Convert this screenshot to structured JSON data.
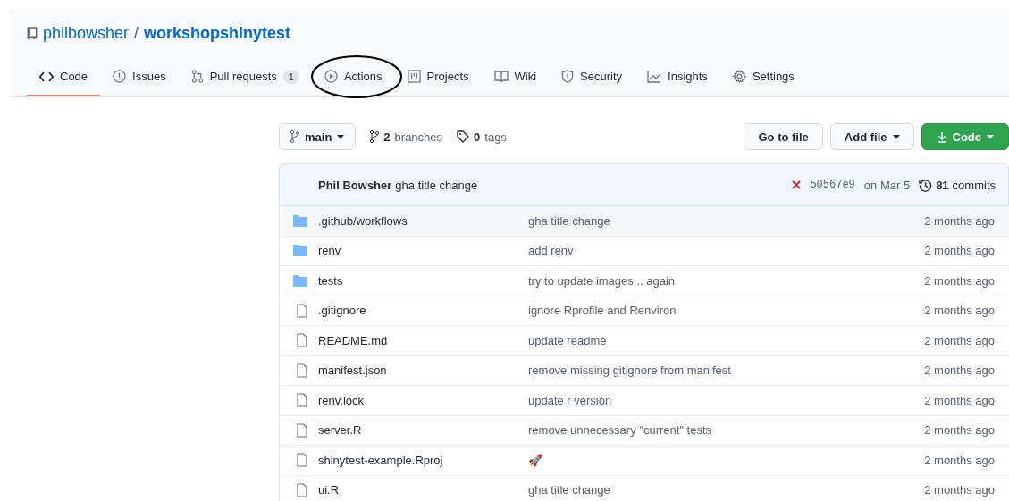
{
  "repo": {
    "owner": "philbowsher",
    "separator": "/",
    "name": "workshopshinytest"
  },
  "tabs": [
    {
      "label": "Code",
      "selected": true,
      "circled": false
    },
    {
      "label": "Issues",
      "selected": false,
      "circled": false
    },
    {
      "label": "Pull requests",
      "selected": false,
      "circled": false,
      "count": "1"
    },
    {
      "label": "Actions",
      "selected": false,
      "circled": true
    },
    {
      "label": "Projects",
      "selected": false,
      "circled": false
    },
    {
      "label": "Wiki",
      "selected": false,
      "circled": false
    },
    {
      "label": "Security",
      "selected": false,
      "circled": false
    },
    {
      "label": "Insights",
      "selected": false,
      "circled": false
    },
    {
      "label": "Settings",
      "selected": false,
      "circled": false
    }
  ],
  "toolbar": {
    "branch": "main",
    "branches_count": "2",
    "branches_label": "branches",
    "tags_count": "0",
    "tags_label": "tags",
    "buttons": [
      {
        "label": "Go to file",
        "kind": "plain"
      },
      {
        "label": "Add file",
        "kind": "dropdown"
      },
      {
        "label": "Code",
        "kind": "primary"
      }
    ]
  },
  "last_commit": {
    "author": "Phil Bowsher",
    "message": "gha title change",
    "ci_passed": false,
    "sha": "50567e9",
    "date": "on Mar 5",
    "commits_count": "81",
    "commits_label": "commits"
  },
  "files": [
    {
      "kind": "folder",
      "name": ".github/workflows",
      "message": "gha title change",
      "age": "2 months ago"
    },
    {
      "kind": "folder",
      "name": "renv",
      "message": "add renv",
      "age": "2 months ago"
    },
    {
      "kind": "folder",
      "name": "tests",
      "message": "try to update images... again",
      "age": "2 months ago"
    },
    {
      "kind": "file",
      "name": ".gitignore",
      "message": "ignore Rprofile and Renviron",
      "age": "2 months ago"
    },
    {
      "kind": "file",
      "name": "README.md",
      "message": "update readme",
      "age": "2 months ago"
    },
    {
      "kind": "file",
      "name": "manifest.json",
      "message": "remove missing gitignore from manifest",
      "age": "2 months ago"
    },
    {
      "kind": "file",
      "name": "renv.lock",
      "message": "update r version",
      "age": "2 months ago"
    },
    {
      "kind": "file",
      "name": "server.R",
      "message": "remove unnecessary \"current\" tests",
      "age": "2 months ago"
    },
    {
      "kind": "file",
      "name": "shinytest-example.Rproj",
      "message": "🚀",
      "age": "2 months ago"
    },
    {
      "kind": "file",
      "name": "ui.R",
      "message": "gha title change",
      "age": "2 months ago"
    }
  ]
}
